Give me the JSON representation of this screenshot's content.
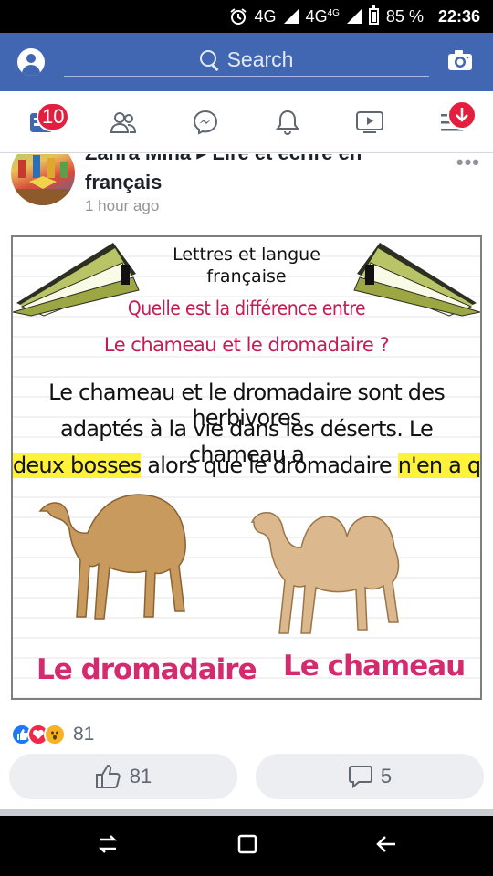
{
  "status_bar": {
    "time": "22:36",
    "battery": "85 %",
    "net1": "4G",
    "net2": "4G",
    "net2_sup": "4G"
  },
  "header": {
    "search_placeholder": "Search"
  },
  "nav": {
    "notification_count": "10"
  },
  "post": {
    "author": "Zahra Mina ▸ Lire et écrire en",
    "author_line2": "français",
    "time": "1 hour ago",
    "image": {
      "title1": "Lettres et langue",
      "title2": "française",
      "question1": "Quelle est la différence  entre",
      "question2": "Le chameau et le dromadaire ?",
      "body1": "Le chameau et le dromadaire sont des herbivores",
      "body2": "adaptés à la vie dans les déserts. Le chameau a",
      "body3_highlight1": "deux bosses",
      "body3_mid": " alors que le dromadaire ",
      "body3_highlight2": "n'en a qu'une.",
      "label_left": "Le dromadaire",
      "label_right": "Le chameau"
    },
    "reaction_count": "81",
    "like_count": "81",
    "comment_count": "5"
  },
  "colors": {
    "fb_blue": "#4267b2",
    "badge_red": "#e41e3f",
    "question_pink": "#c81a52",
    "highlight": "#fff23a",
    "label_pink": "#d42a6e"
  }
}
